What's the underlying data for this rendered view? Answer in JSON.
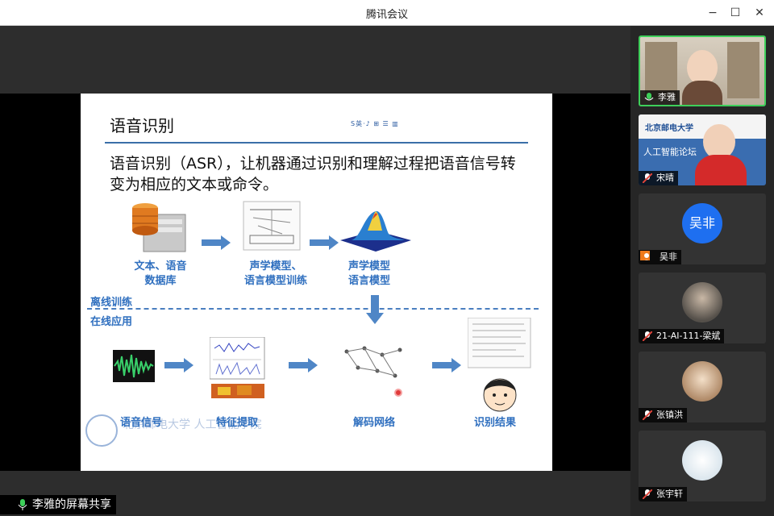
{
  "window": {
    "title": "腾讯会议"
  },
  "slide": {
    "heading": "语音识别",
    "logo_text": "S英·♪ ⊞ ☰ ▥",
    "description": "语音识别（ASR），让机器通过识别和理解过程把语音信号转变为相应的文本或命令。",
    "offline_label": "离线训练",
    "online_label": "在线应用",
    "steps_top": [
      {
        "label": "文本、语音\n数据库"
      },
      {
        "label": "声学模型、\n语言模型训练"
      },
      {
        "label": "声学模型\n语言模型"
      }
    ],
    "steps_bottom": [
      {
        "label": "语音信号"
      },
      {
        "label": "特征提取"
      },
      {
        "label": "解码网络"
      },
      {
        "label": "识别结果"
      }
    ],
    "watermark": "北京邮电大学  人工智能学院"
  },
  "participants": [
    {
      "name": "李雅",
      "mic": "on",
      "active": true,
      "video": true
    },
    {
      "name": "宋晴",
      "mic": "muted",
      "active": false,
      "video": true,
      "banner_text": "人工智能论坛",
      "banner_school": "北京邮电大学"
    },
    {
      "name": "吴非",
      "mic": "none",
      "active": false,
      "avatar_text": "吴非",
      "avatar_color": "#1e6ff0"
    },
    {
      "name": "21-AI-111-梁斌",
      "mic": "muted",
      "active": false
    },
    {
      "name": "张镇洪",
      "mic": "muted",
      "active": false
    },
    {
      "name": "张宇轩",
      "mic": "muted",
      "active": false
    }
  ],
  "share_status": "李雅的屏幕共享",
  "colors": {
    "accent": "#2f6fbf",
    "active_border": "#3ecf5a",
    "mic_muted": "#e0443a"
  }
}
